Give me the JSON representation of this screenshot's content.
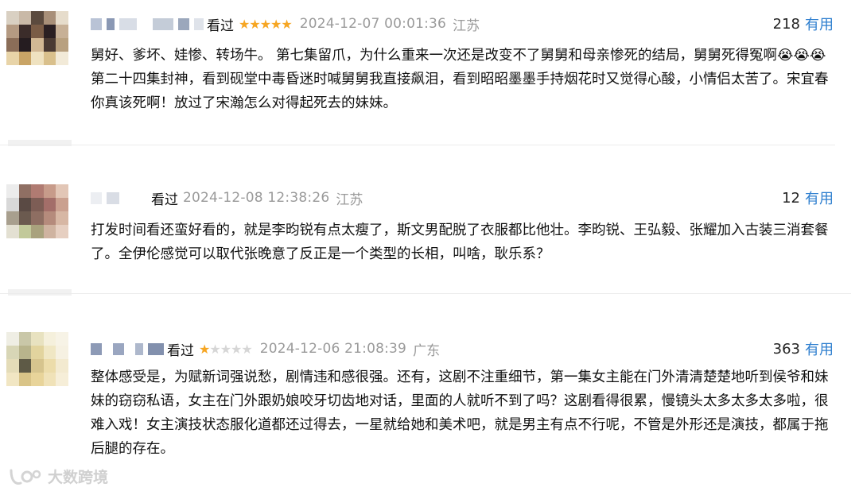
{
  "comments": [
    {
      "watched_label": "看过",
      "rating": 5,
      "time": "2024-12-07 00:01:36",
      "location": "江苏",
      "votes": "218",
      "useful_label": "有用",
      "text": "舅好、爹坏、娃惨、转场牛。 第七集留爪，为什么重来一次还是改变不了舅舅和母亲惨死的结局，舅舅死得冤啊😭😭😭 第二十四集封神，看到砚堂中毒昏迷时喊舅舅我直接飙泪，看到昭昭墨墨手持烟花时又觉得心酸，小情侣太苦了。宋宜春你真该死啊！放过了宋瀚怎么对得起死去的妹妹。"
    },
    {
      "watched_label": "看过",
      "rating": 0,
      "time": "2024-12-08 12:38:26",
      "location": "江苏",
      "votes": "12",
      "useful_label": "有用",
      "text": "打发时间看还蛮好看的，就是李昀锐有点太瘦了，斯文男配脱了衣服都比他壮。李昀锐、王弘毅、张耀加入古装三消套餐了。全伊伦感觉可以取代张晚意了反正是一个类型的长相，叫啥，耿乐系？"
    },
    {
      "watched_label": "看过",
      "rating": 1,
      "time": "2024-12-06 21:08:39",
      "location": "广东",
      "votes": "363",
      "useful_label": "有用",
      "text": "整体感受是，为赋新词强说愁，剧情违和感很强。还有，这剧不注重细节，第一集女主能在门外清清楚楚地听到侯爷和妹妹的窃窃私语，女主在门外跟奶娘咬牙切齿地对话，里面的人就听不到了吗？这剧看得很累，慢镜头太多太多太多啦，很难入戏！女主演技状态服化道都还过得去，一星就给她和美术吧，就是男主有点不行呢，不管是外形还是演技，都属于拖后腿的存在。"
    }
  ],
  "watermark": "大数跨境",
  "colors": {
    "star_on": "#f6a623",
    "star_off": "#d6d6d6",
    "useful_link": "#2f7fcf",
    "meta_gray": "#9a9a9a"
  },
  "avatars": [
    [
      "#d9d0c2",
      "#c9b9a7",
      "#5b4a3e",
      "#a88f78",
      "#e6dccb",
      "#b49a82",
      "#3b2c2a",
      "#7a5c46",
      "#2a1f22",
      "#c7b096",
      "#8a6d58",
      "#251c20",
      "#d2b894",
      "#4a3a33",
      "#b8a07f",
      "#e8d4a8",
      "#c9a466",
      "#efe2c0",
      "#d9c08c",
      "#f2ead8"
    ],
    [
      "#ececec",
      "#8f6f63",
      "#b07b72",
      "#c79b8a",
      "#e2c6b6",
      "#d8d8d8",
      "#5a4a44",
      "#7d5d55",
      "#a36e69",
      "#caa08f",
      "#a89f8e",
      "#6b5a4f",
      "#8e6e62",
      "#b58b7c",
      "#d7b7a4",
      "#e3e0d2",
      "#c2c99a",
      "#a9a27d",
      "#cfb3a0",
      "#e6cfc1"
    ],
    [
      "#efeee4",
      "#c9c7a8",
      "#e8e2c0",
      "#f5f0dc",
      "#f7f3e6",
      "#d8d6b6",
      "#b8b48c",
      "#e2d49e",
      "#f0e7c4",
      "#f6f1e2",
      "#e4dcb8",
      "#5e5a46",
      "#d6c48e",
      "#ecdcaa",
      "#f3ead0",
      "#f1e6c3",
      "#d9c488",
      "#e8d49a",
      "#f0e2b8",
      "#f6eed8"
    ]
  ]
}
